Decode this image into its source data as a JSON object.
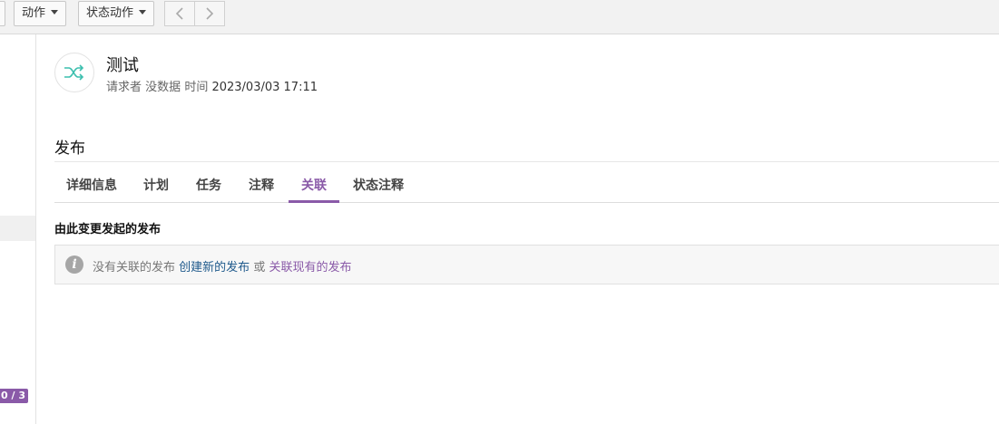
{
  "toolbar": {
    "actions_label": "动作",
    "state_actions_label": "状态动作"
  },
  "sidebar": {
    "counter_badge": "0 / 3"
  },
  "record": {
    "icon": "shuffle-icon",
    "title": "测试",
    "requester_label": "请求者",
    "requester_value": "没数据",
    "time_label": "时间",
    "time_value": "2023/03/03 17:11"
  },
  "section": {
    "title": "发布"
  },
  "tabs": [
    {
      "label": "详细信息",
      "active": false
    },
    {
      "label": "计划",
      "active": false
    },
    {
      "label": "任务",
      "active": false
    },
    {
      "label": "注释",
      "active": false
    },
    {
      "label": "关联",
      "active": true
    },
    {
      "label": "状态注释",
      "active": false
    }
  ],
  "related": {
    "heading": "由此变更发起的发布",
    "empty_text": "没有关联的发布",
    "create_link": "创建新的发布",
    "or_text": "或",
    "link_existing": "关联现有的发布"
  },
  "colors": {
    "accent": "#8a5aa8",
    "icon_teal": "#3cbfae",
    "link_blue": "#1f5a8c"
  }
}
